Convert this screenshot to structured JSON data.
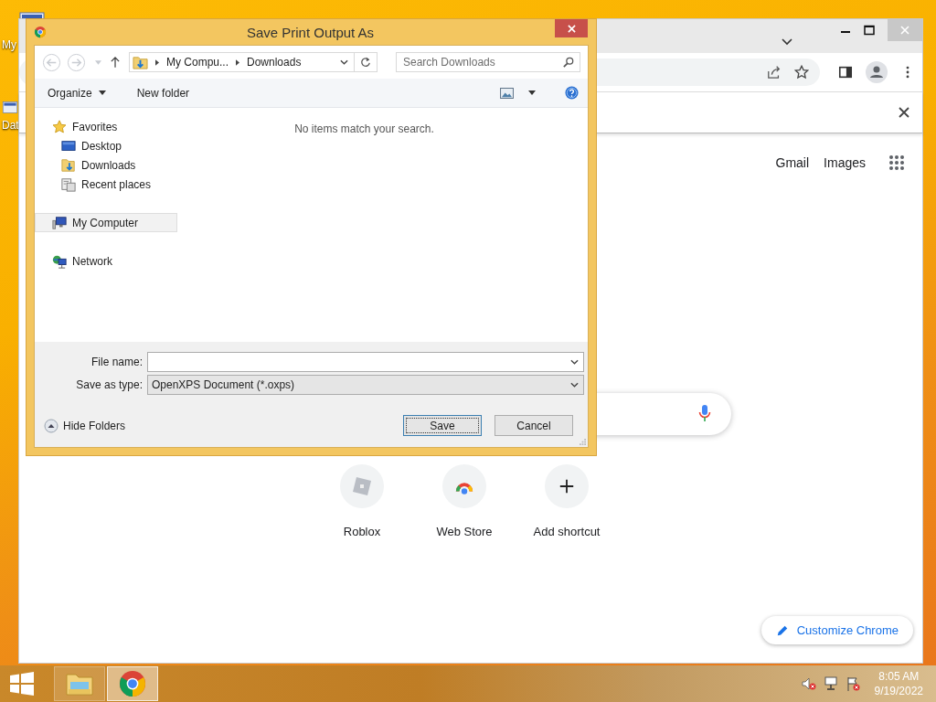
{
  "desktop": {
    "icon_labels": [
      "My",
      "Dat"
    ]
  },
  "browser": {
    "links": [
      "Gmail",
      "Images"
    ],
    "shortcuts": [
      {
        "label": "Roblox",
        "kind": "roblox"
      },
      {
        "label": "Web Store",
        "kind": "webstore"
      },
      {
        "label": "Add shortcut",
        "kind": "add"
      }
    ],
    "customize_button": "Customize Chrome"
  },
  "dialog": {
    "title": "Save Print Output As",
    "nav_buttons": [
      {
        "kind": "back",
        "disabled": true
      },
      {
        "kind": "forward",
        "disabled": true
      }
    ],
    "breadcrumb": [
      "My Compu...",
      "Downloads"
    ],
    "search": {
      "placeholder": "Search Downloads"
    },
    "commands": [
      {
        "label": "Organize",
        "kind": "menu"
      },
      {
        "label": "New folder",
        "kind": "plain"
      }
    ],
    "nav": [
      {
        "label": "Favorites",
        "kind": "star",
        "selected": false,
        "children": [
          {
            "label": "Desktop",
            "kind": "desktop",
            "selected": false
          },
          {
            "label": "Downloads",
            "kind": "downloads",
            "selected": false
          },
          {
            "label": "Recent places",
            "kind": "recent",
            "selected": false
          }
        ]
      },
      {
        "label": "My Computer",
        "kind": "computer",
        "selected": true
      },
      {
        "label": "Network",
        "kind": "network",
        "selected": false
      }
    ],
    "empty_message": "No items match your search.",
    "file_name": {
      "label": "File name:"
    },
    "save_as_type": {
      "label": "Save as type:",
      "value": "OpenXPS Document (*.oxps)"
    },
    "hide_folders": "Hide Folders",
    "buttons": [
      {
        "label": "Save",
        "default": true
      },
      {
        "label": "Cancel",
        "default": false
      }
    ]
  },
  "taskbar": {
    "apps": [
      {
        "kind": "explorer",
        "active": false
      },
      {
        "kind": "chrome",
        "active": true
      }
    ],
    "time": "8:05 AM",
    "date": "9/19/2022"
  }
}
